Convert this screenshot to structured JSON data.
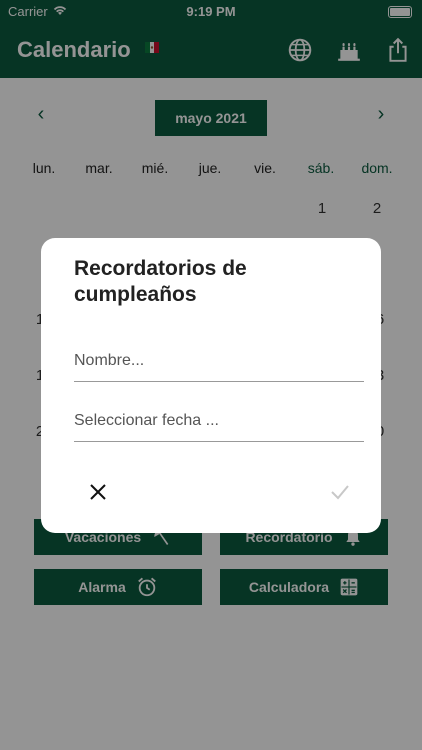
{
  "status_bar": {
    "carrier": "Carrier",
    "time": "9:19 PM"
  },
  "app_bar": {
    "title": "Calendario"
  },
  "calendar": {
    "month_label": "mayo 2021",
    "weekdays": [
      "lun.",
      "mar.",
      "mié.",
      "jue.",
      "vie.",
      "sáb.",
      "dom."
    ],
    "visible_days": {
      "row1": [
        "1",
        "2"
      ],
      "left_partial": [
        "1",
        "1",
        "2"
      ],
      "right_partial": [
        "6",
        "3",
        "0"
      ]
    }
  },
  "actions": {
    "vacaciones": "Vacaciones",
    "recordatorio": "Recordatorio",
    "alarma": "Alarma",
    "calculadora": "Calculadora"
  },
  "dialog": {
    "title": "Recordatorios de cumpleaños",
    "name_placeholder": "Nombre...",
    "date_placeholder": "Seleccionar fecha ..."
  },
  "colors": {
    "primary": "#0b5a3e",
    "overlay": "#000000"
  }
}
